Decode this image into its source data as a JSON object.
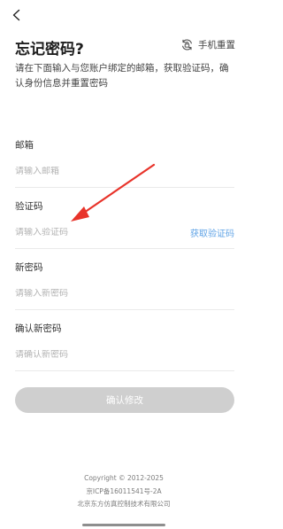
{
  "header": {
    "back_icon": "chevron-left-icon",
    "title": "忘记密码?",
    "phone_reset_label": "手机重置",
    "phone_reset_icon": "refresh-lock-icon"
  },
  "subtitle": "请在下面输入与您账户绑定的邮箱，获取验证码，确认身份信息并重置密码",
  "form": {
    "email": {
      "label": "邮箱",
      "placeholder": "请输入邮箱",
      "value": ""
    },
    "code": {
      "label": "验证码",
      "placeholder": "请输入验证码",
      "value": "",
      "get_code_label": "获取验证码"
    },
    "new_password": {
      "label": "新密码",
      "placeholder": "请输入新密码",
      "value": ""
    },
    "confirm_password": {
      "label": "确认新密码",
      "placeholder": "请确认新密码",
      "value": ""
    }
  },
  "confirm_button": "确认修改",
  "footer": {
    "copyright": "Copyright © 2012-2025",
    "icp": "京ICP备16011541号-2A",
    "company": "北京东方仿真控制技术有限公司"
  },
  "colors": {
    "accent_link": "#5fa3e6",
    "button_disabled": "#cfcfcf",
    "annotation_arrow": "#e8332a"
  }
}
